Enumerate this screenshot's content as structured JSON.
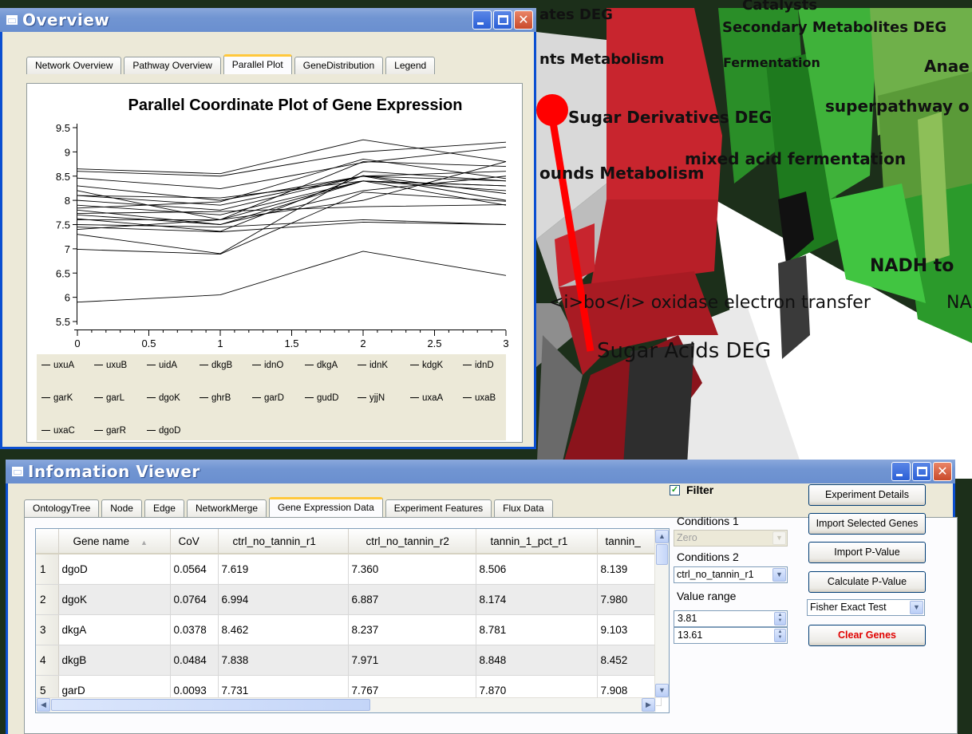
{
  "scene": {
    "labels": [
      "ates DEG",
      "Secondary Metabolites DEG",
      "Catalysts",
      "nts Metabolism",
      "Fermentation",
      "Anae",
      "Sugar Derivatives DEG",
      "superpathway o",
      "mixed acid fermentation",
      "ounds Metabolism",
      "NADH to",
      "<i>bo</i> oxidase electron transfer",
      "NA",
      "Sugar Acids DEG"
    ]
  },
  "overview": {
    "title": "Overview",
    "tabs": [
      "Network Overview",
      "Pathway Overview",
      "Parallel Plot",
      "GeneDistribution",
      "Legend"
    ],
    "active_tab": "Parallel Plot"
  },
  "chart_data": {
    "type": "line",
    "title": "Parallel Coordinate Plot of Gene Expression",
    "x": [
      0,
      1,
      2,
      3
    ],
    "xticks": [
      "0",
      "0.5",
      "1",
      "1.5",
      "2",
      "2.5",
      "3"
    ],
    "yticks": [
      "9.5",
      "9",
      "8.5",
      "8",
      "7.5",
      "7",
      "6.5",
      "6",
      "5.5"
    ],
    "xlim": [
      0,
      3
    ],
    "ylim": [
      5.5,
      9.5
    ],
    "grid": false,
    "legend_position": "bottom",
    "series": [
      {
        "name": "uxuA",
        "values": [
          8.1,
          7.9,
          8.5,
          8.0
        ]
      },
      {
        "name": "uxuB",
        "values": [
          7.9,
          7.7,
          8.4,
          8.3
        ]
      },
      {
        "name": "uidA",
        "values": [
          7.6,
          7.6,
          8.8,
          8.7
        ]
      },
      {
        "name": "dkgB",
        "values": [
          7.84,
          7.97,
          8.85,
          8.45
        ]
      },
      {
        "name": "idnO",
        "values": [
          8.3,
          8.0,
          8.5,
          8.4
        ]
      },
      {
        "name": "dkgA",
        "values": [
          8.46,
          8.24,
          8.78,
          9.1
        ]
      },
      {
        "name": "idnK",
        "values": [
          7.5,
          7.45,
          7.6,
          7.5
        ]
      },
      {
        "name": "kdgK",
        "values": [
          8.6,
          8.5,
          9.0,
          9.2
        ]
      },
      {
        "name": "idnD",
        "values": [
          7.8,
          7.5,
          8.4,
          7.9
        ]
      },
      {
        "name": "garK",
        "values": [
          7.7,
          7.5,
          8.2,
          8.5
        ]
      },
      {
        "name": "garL",
        "values": [
          8.0,
          7.8,
          8.5,
          8.6
        ]
      },
      {
        "name": "dgoK",
        "values": [
          6.99,
          6.89,
          8.17,
          7.98
        ]
      },
      {
        "name": "ghrB",
        "values": [
          8.65,
          8.55,
          9.25,
          8.8
        ]
      },
      {
        "name": "garD",
        "values": [
          7.73,
          7.77,
          7.87,
          7.91
        ]
      },
      {
        "name": "gudD",
        "values": [
          7.4,
          7.6,
          8.0,
          8.8
        ]
      },
      {
        "name": "yjjN",
        "values": [
          8.2,
          7.6,
          8.4,
          8.3
        ]
      },
      {
        "name": "uxaA",
        "values": [
          7.45,
          7.35,
          7.55,
          7.5
        ]
      },
      {
        "name": "uxaB",
        "values": [
          7.3,
          6.9,
          8.6,
          8.4
        ]
      },
      {
        "name": "uxaC",
        "values": [
          8.1,
          8.05,
          8.4,
          8.2
        ]
      },
      {
        "name": "garR",
        "values": [
          5.9,
          6.05,
          6.95,
          6.45
        ]
      },
      {
        "name": "dgoD",
        "values": [
          7.62,
          7.36,
          8.51,
          8.14
        ]
      }
    ]
  },
  "info": {
    "title": "Infomation Viewer",
    "tabs": [
      "OntologyTree",
      "Node",
      "Edge",
      "NetworkMerge",
      "Gene Expression Data",
      "Experiment Features",
      "Flux Data"
    ],
    "active_tab": "Gene Expression Data",
    "columns": [
      "Gene name",
      "CoV",
      "ctrl_no_tannin_r1",
      "ctrl_no_tannin_r2",
      "tannin_1_pct_r1",
      "tannin_"
    ],
    "rows": [
      {
        "num": "1",
        "cells": [
          "dgoD",
          "0.0564",
          "7.619",
          "7.360",
          "8.506",
          "8.139"
        ]
      },
      {
        "num": "2",
        "cells": [
          "dgoK",
          "0.0764",
          "6.994",
          "6.887",
          "8.174",
          "7.980"
        ]
      },
      {
        "num": "3",
        "cells": [
          "dkgA",
          "0.0378",
          "8.462",
          "8.237",
          "8.781",
          "9.103"
        ]
      },
      {
        "num": "4",
        "cells": [
          "dkgB",
          "0.0484",
          "7.838",
          "7.971",
          "8.848",
          "8.452"
        ]
      },
      {
        "num": "5",
        "cells": [
          "garD",
          "0.0093",
          "7.731",
          "7.767",
          "7.870",
          "7.908"
        ]
      }
    ],
    "filter_label": "Filter",
    "filter_checked": true,
    "conditions1_label": "Conditions 1",
    "conditions1_value": "Zero",
    "conditions2_label": "Conditions 2",
    "conditions2_value": "ctrl_no_tannin_r1",
    "value_range_label": "Value range",
    "range_min": "3.81",
    "range_max": "13.61",
    "buttons": {
      "experiment_details": "Experiment Details",
      "import_selected": "Import Selected Genes",
      "import_pvalue": "Import P-Value",
      "calculate_pvalue": "Calculate P-Value",
      "clear_genes": "Clear Genes"
    },
    "test_value": "Fisher Exact Test"
  }
}
